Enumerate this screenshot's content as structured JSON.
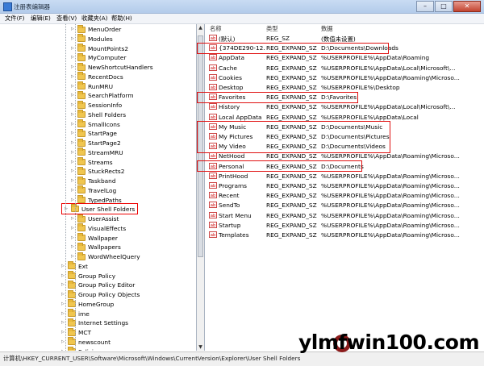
{
  "window": {
    "title": "注册表编辑器",
    "minimize": "–",
    "maximize": "□",
    "close": "✕"
  },
  "menu": [
    "文件(F)",
    "编辑(E)",
    "查看(V)",
    "收藏夹(A)",
    "帮助(H)"
  ],
  "tree": {
    "items": [
      {
        "label": "MenuOrder"
      },
      {
        "label": "Modules"
      },
      {
        "label": "MountPoints2"
      },
      {
        "label": "MyComputer"
      },
      {
        "label": "NewShortcutHandlers"
      },
      {
        "label": "RecentDocs"
      },
      {
        "label": "RunMRU"
      },
      {
        "label": "SearchPlatform"
      },
      {
        "label": "SessionInfo"
      },
      {
        "label": "Shell Folders"
      },
      {
        "label": "SmallIcons"
      },
      {
        "label": "StartPage"
      },
      {
        "label": "StartPage2"
      },
      {
        "label": "StreamMRU"
      },
      {
        "label": "Streams"
      },
      {
        "label": "StuckRects2"
      },
      {
        "label": "Taskband"
      },
      {
        "label": "TravelLog"
      },
      {
        "label": "TypedPaths"
      },
      {
        "label": "User Shell Folders"
      },
      {
        "label": "UserAssist"
      },
      {
        "label": "VisualEffects"
      },
      {
        "label": "Wallpaper"
      },
      {
        "label": "Wallpapers"
      },
      {
        "label": "WordWheelQuery"
      },
      {
        "label": "Ext"
      },
      {
        "label": "Group Policy"
      },
      {
        "label": "Group Policy Editor"
      },
      {
        "label": "Group Policy Objects"
      },
      {
        "label": "HomeGroup"
      },
      {
        "label": "ime"
      },
      {
        "label": "Internet Settings"
      },
      {
        "label": "MCT"
      },
      {
        "label": "newscount"
      },
      {
        "label": "Policies"
      }
    ]
  },
  "list": {
    "columns": [
      "名称",
      "类型",
      "数据"
    ],
    "rows": [
      {
        "name": "(默认)",
        "type": "REG_SZ",
        "data": "(数值未设置)"
      },
      {
        "name": "{374DE290-12...",
        "type": "REG_EXPAND_SZ",
        "data": "D:\\Documents\\Downloads"
      },
      {
        "name": "AppData",
        "type": "REG_EXPAND_SZ",
        "data": "%USERPROFILE%\\AppData\\Roaming"
      },
      {
        "name": "Cache",
        "type": "REG_EXPAND_SZ",
        "data": "%USERPROFILE%\\AppData\\Local\\Microsoft\\..."
      },
      {
        "name": "Cookies",
        "type": "REG_EXPAND_SZ",
        "data": "%USERPROFILE%\\AppData\\Roaming\\Microso..."
      },
      {
        "name": "Desktop",
        "type": "REG_EXPAND_SZ",
        "data": "%USERPROFILE%\\Desktop"
      },
      {
        "name": "Favorites",
        "type": "REG_EXPAND_SZ",
        "data": "D:\\Favorites"
      },
      {
        "name": "History",
        "type": "REG_EXPAND_SZ",
        "data": "%USERPROFILE%\\AppData\\Local\\Microsoft\\..."
      },
      {
        "name": "Local AppData",
        "type": "REG_EXPAND_SZ",
        "data": "%USERPROFILE%\\AppData\\Local"
      },
      {
        "name": "My Music",
        "type": "REG_EXPAND_SZ",
        "data": "D:\\Documents\\Music"
      },
      {
        "name": "My Pictures",
        "type": "REG_EXPAND_SZ",
        "data": "D:\\Documents\\Pictures"
      },
      {
        "name": "My Video",
        "type": "REG_EXPAND_SZ",
        "data": "D:\\Documents\\Videos"
      },
      {
        "name": "NetHood",
        "type": "REG_EXPAND_SZ",
        "data": "%USERPROFILE%\\AppData\\Roaming\\Microso..."
      },
      {
        "name": "Personal",
        "type": "REG_EXPAND_SZ",
        "data": "D:\\Documents"
      },
      {
        "name": "PrintHood",
        "type": "REG_EXPAND_SZ",
        "data": "%USERPROFILE%\\AppData\\Roaming\\Microso..."
      },
      {
        "name": "Programs",
        "type": "REG_EXPAND_SZ",
        "data": "%USERPROFILE%\\AppData\\Roaming\\Microso..."
      },
      {
        "name": "Recent",
        "type": "REG_EXPAND_SZ",
        "data": "%USERPROFILE%\\AppData\\Roaming\\Microso..."
      },
      {
        "name": "SendTo",
        "type": "REG_EXPAND_SZ",
        "data": "%USERPROFILE%\\AppData\\Roaming\\Microso..."
      },
      {
        "name": "Start Menu",
        "type": "REG_EXPAND_SZ",
        "data": "%USERPROFILE%\\AppData\\Roaming\\Microso..."
      },
      {
        "name": "Startup",
        "type": "REG_EXPAND_SZ",
        "data": "%USERPROFILE%\\AppData\\Roaming\\Microso..."
      },
      {
        "name": "Templates",
        "type": "REG_EXPAND_SZ",
        "data": "%USERPROFILE%\\AppData\\Roaming\\Microso..."
      }
    ]
  },
  "status": {
    "path": "计算机\\HKEY_CURRENT_USER\\Software\\Microsoft\\Windows\\CurrentVersion\\Explorer\\User Shell Folders"
  },
  "watermark": "ylmfwin100.com",
  "colors": {
    "highlight": "#e01010",
    "folder": "#f0c650"
  }
}
